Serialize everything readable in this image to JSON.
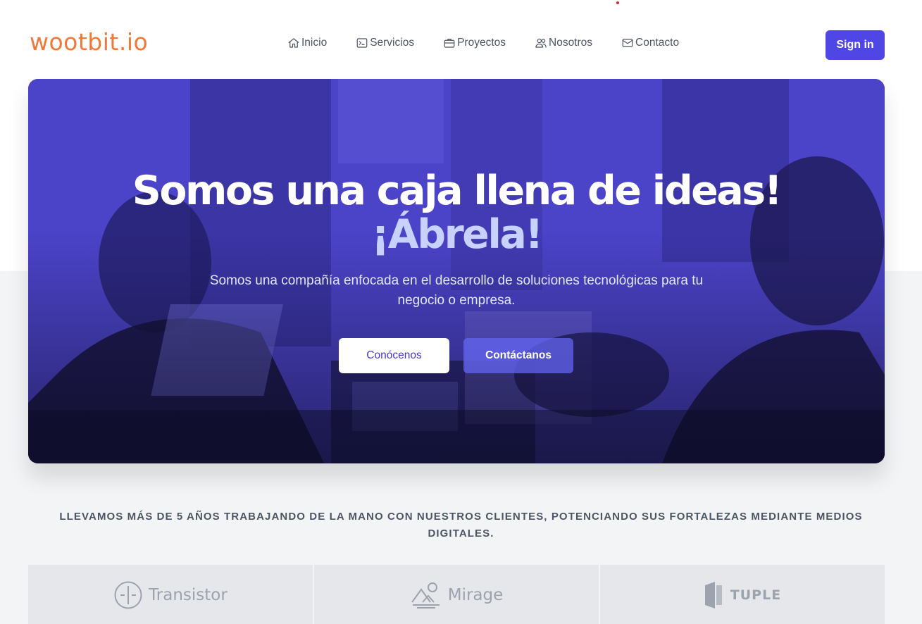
{
  "header": {
    "logo": "wootbit.io",
    "nav": [
      {
        "label": "Inicio",
        "icon": "home-icon"
      },
      {
        "label": "Servicios",
        "icon": "terminal-icon"
      },
      {
        "label": "Proyectos",
        "icon": "briefcase-icon"
      },
      {
        "label": "Nosotros",
        "icon": "users-icon"
      },
      {
        "label": "Contacto",
        "icon": "mail-icon"
      }
    ],
    "signin_label": "Sign in"
  },
  "hero": {
    "title_line1": "Somos una caja llena de ideas!",
    "title_line2": "¡Ábrela!",
    "subtitle": "Somos una compañía enfocada en el desarrollo de soluciones tecnológicas para tu negocio o empresa.",
    "primary_button": "Conócenos",
    "secondary_button": "Contáctanos"
  },
  "tagline": "LLEVAMOS MÁS DE 5 AÑOS TRABAJANDO DE LA MANO CON NUESTROS CLIENTES, POTENCIANDO SUS FORTALEZAS MEDIANTE MEDIOS DIGITALES.",
  "client_logos": [
    {
      "name": "Transistor",
      "icon": "transistor-icon"
    },
    {
      "name": "Mirage",
      "icon": "mirage-icon"
    },
    {
      "name": "TUPLE",
      "icon": "tuple-icon"
    }
  ],
  "colors": {
    "brand_orange": "#f0793a",
    "primary": "#4f46e5",
    "hero_tint": "#4b43c8"
  }
}
